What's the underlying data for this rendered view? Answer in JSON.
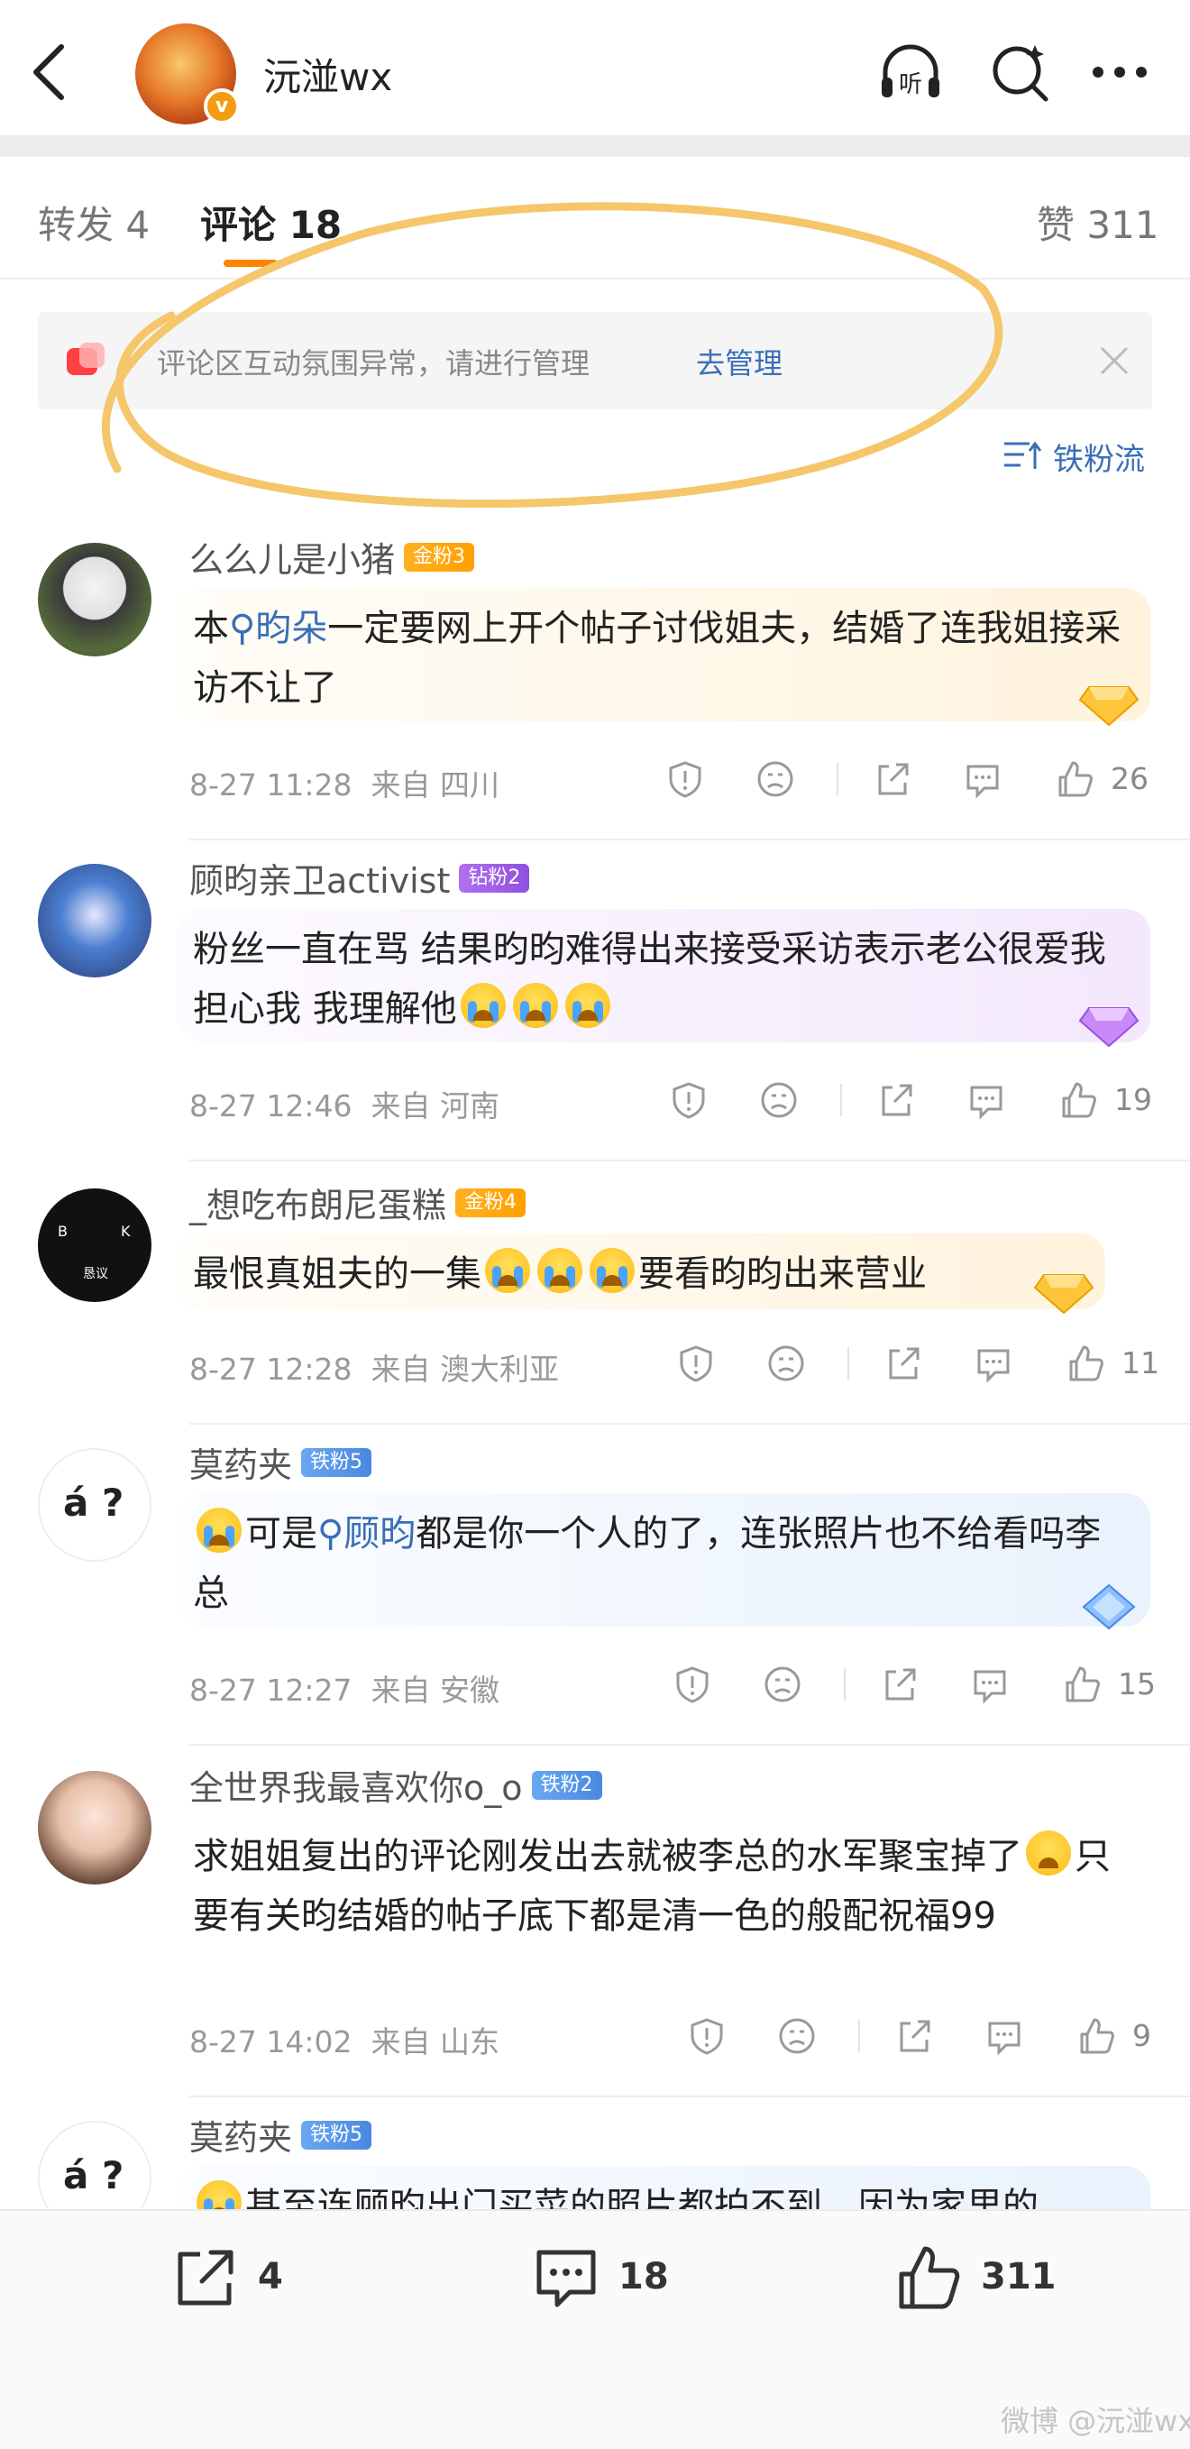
{
  "header": {
    "title": "沅湴wx",
    "verified_badge": "v",
    "icons": [
      "back-icon",
      "listen-icon",
      "search-icon",
      "more-icon"
    ],
    "listen_label": "听"
  },
  "tabs": [
    {
      "label": "转发 4"
    },
    {
      "label": "评论 18"
    },
    {
      "label": "赞 311"
    }
  ],
  "notice": {
    "text": "评论区互动氛围异常，请进行管理",
    "link": "去管理"
  },
  "sort": {
    "label": "铁粉流"
  },
  "colors": {
    "accent": "#ff8200",
    "link": "#3a6fb6",
    "gold_badge": "#ffa000",
    "diamond_badge": "#9050e0",
    "iron_badge": "#4a88e0",
    "annotation": "#f5c66a"
  },
  "comments": [
    {
      "name": "么么儿是小猪",
      "badge": "金粉3",
      "badge_type": "gold",
      "text_before": "本",
      "tag": "昀朵",
      "text_after": "一定要网上开个帖子讨伐姐夫，结婚了连我姐接采访不让了",
      "time": "8-27 11:28",
      "location": "来自 四川",
      "likes": "26"
    },
    {
      "name": "顾昀亲卫activist",
      "badge": "钻粉2",
      "badge_type": "diamond",
      "text_before": "粉丝一直在骂 结果昀昀难得出来接受采访表示老公很爱我担心我 我理解他",
      "tag": "",
      "text_after": "",
      "time": "8-27 12:46",
      "location": "来自 河南",
      "likes": "19"
    },
    {
      "name": "_想吃布朗尼蛋糕",
      "badge": "金粉4",
      "badge_type": "gold",
      "text_before": "最恨真姐夫的一集",
      "tag": "",
      "text_after": "要看昀昀出来营业",
      "time": "8-27 12:28",
      "location": "来自 澳大利亚",
      "likes": "11"
    },
    {
      "name": "莫药夹",
      "badge": "铁粉5",
      "badge_type": "iron",
      "text_before": "可是",
      "tag": "顾昀",
      "text_after": "都是你一个人的了，连张照片也不给看吗李总",
      "time": "8-27 12:27",
      "location": "来自 安徽",
      "likes": "15"
    },
    {
      "name": "全世界我最喜欢你o_o",
      "badge": "铁粉2",
      "badge_type": "iron",
      "text_before": "求姐姐复出的评论刚发出去就被李总的水军聚宝掉了",
      "tag": "",
      "text_after": "只要有关昀结婚的帖子底下都是清一色的般配祝福99",
      "time": "8-27 14:02",
      "location": "来自 山东",
      "likes": "9"
    },
    {
      "name": "莫药夹",
      "badge": "铁粉5",
      "badge_type": "iron",
      "text_before": "甚至连顾昀出门买菜的照片都拍不到，因为家里的",
      "tag": "",
      "text_after": "",
      "time": "",
      "location": "",
      "likes": ""
    }
  ],
  "avatar_labels": {
    "c3_left": "B",
    "c3_right": "K",
    "c3_bottom": "恳议",
    "c4": "á ?",
    "c6": "á ?"
  },
  "bottom_bar": {
    "repost_count": "4",
    "comment_count": "18",
    "like_count": "311"
  },
  "watermark": "微博 @沅湴wx"
}
